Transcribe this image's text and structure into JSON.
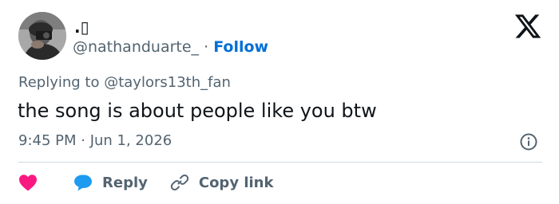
{
  "author": {
    "display_name": ".▯",
    "handle": "@nathanduarte_",
    "separator": "·",
    "follow_label": "Follow"
  },
  "reply_context": {
    "prefix": "Replying to",
    "mention": "@taylors13th_fan"
  },
  "tweet": {
    "text": "the song is about people like you btw",
    "timestamp": "9:45 PM · Jun 1, 2026"
  },
  "actions": {
    "reply_label": "Reply",
    "copy_link_label": "Copy link"
  },
  "colors": {
    "text_primary": "#0f1419",
    "text_secondary": "#536471",
    "follow_blue": "#006fd6",
    "like_red": "#f91880",
    "reply_blue": "#1d9bf0",
    "divider": "#cfd9de"
  },
  "icons": {
    "brand": "x-logo-icon",
    "info": "info-icon",
    "like": "heart-icon",
    "reply": "reply-bubble-icon",
    "copy_link": "link-icon"
  }
}
